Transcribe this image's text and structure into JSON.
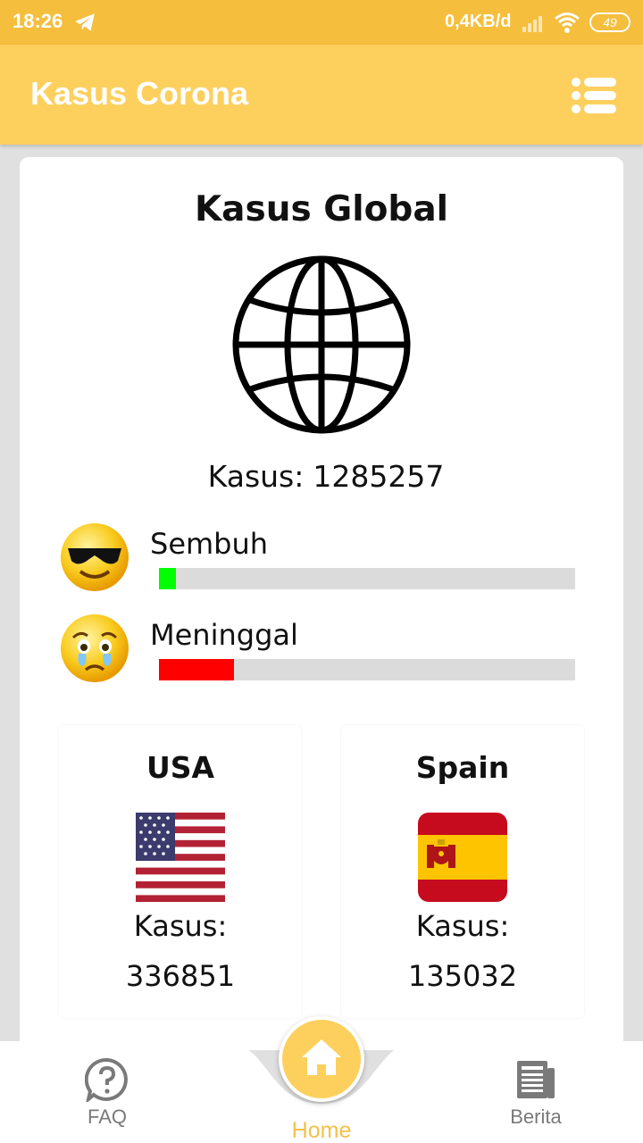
{
  "status_bar": {
    "time": "18:26",
    "net_speed": "0,4KB/d",
    "battery": "49"
  },
  "app_bar": {
    "title": "Kasus Corona"
  },
  "global": {
    "title": "Kasus Global",
    "cases_label": "Kasus:",
    "cases_value": "1285257"
  },
  "stats": {
    "recovered": {
      "label": "Sembuh",
      "fraction": 0.04,
      "color": "#00ff00"
    },
    "deaths": {
      "label": "Meninggal",
      "fraction": 0.18,
      "color": "#ff0000"
    }
  },
  "countries": [
    {
      "name": "USA",
      "cases_label": "Kasus:",
      "cases_value": "336851"
    },
    {
      "name": "Spain",
      "cases_label": "Kasus:",
      "cases_value": "135032"
    }
  ],
  "bottom_nav": {
    "faq_label": "FAQ",
    "home_label": "Home",
    "berita_label": "Berita"
  },
  "colors": {
    "status_bar": "#f5be3c",
    "app_bar": "#fdd05e",
    "home_accent": "#f5c04a"
  }
}
